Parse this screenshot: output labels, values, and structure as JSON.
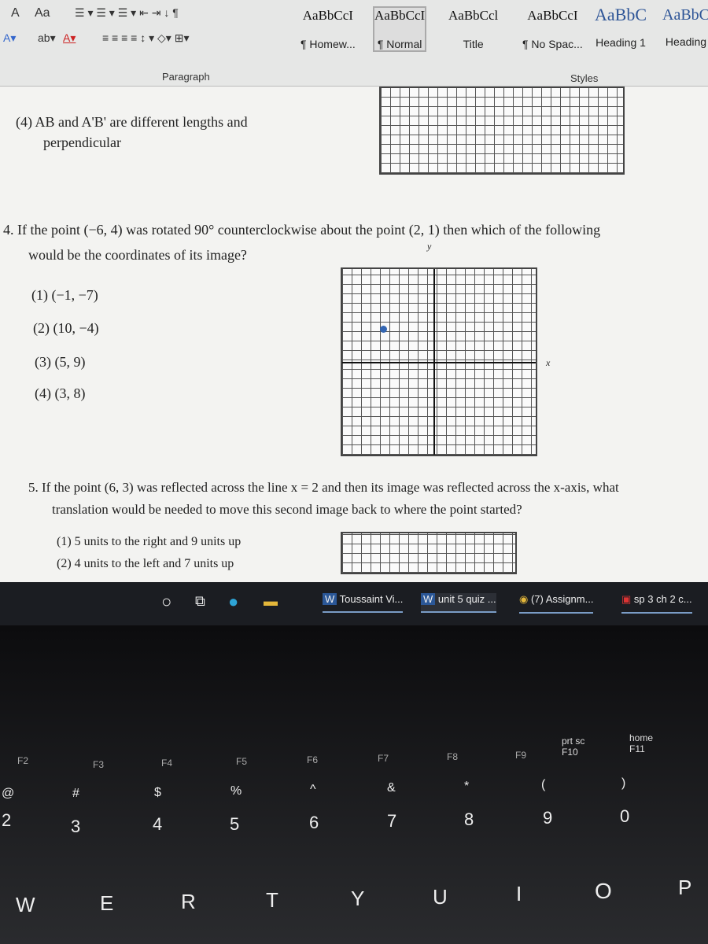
{
  "ribbon": {
    "font_size_label": "Aa",
    "paragraph_group": "Paragraph",
    "styles_group": "Styles",
    "styles": [
      {
        "preview": "AaBbCcI",
        "label": "¶ Homew..."
      },
      {
        "preview": "AaBbCcI",
        "label": "¶ Normal"
      },
      {
        "preview": "AaBbCcl",
        "label": "Title"
      },
      {
        "preview": "AaBbCcI",
        "label": "¶ No Spac..."
      },
      {
        "preview": "AaBbC",
        "label": "Heading 1"
      },
      {
        "preview": "AaBbC",
        "label": "Heading"
      }
    ]
  },
  "document": {
    "prev_choice_4a": "(4) AB and A'B' are different lengths and",
    "prev_choice_4b": "perpendicular",
    "q4_line1": "4. If the point (−6, 4) was rotated 90° counterclockwise about the point (2, 1) then which of the following",
    "q4_line2": "would be the coordinates of its image?",
    "q4_choices": [
      "(1) (−1, −7)",
      "(2) (10, −4)",
      "(3) (5, 9)",
      "(4) (3, 8)"
    ],
    "axis_y": "y",
    "axis_x": "x",
    "q5_line1": "5. If the point (6, 3) was reflected across the line x = 2 and then its image was reflected across the x-axis, what",
    "q5_line2": "translation would be needed to move this second image back to where the point started?",
    "q5_choices": [
      "(1) 5 units to the right and 9 units up",
      "(2) 4 units to the left and 7 units up"
    ]
  },
  "taskbar": {
    "items": [
      {
        "icon": "word-icon",
        "label": "Toussaint Vi..."
      },
      {
        "icon": "word-icon",
        "label": "unit 5 quiz ..."
      },
      {
        "icon": "chrome-icon",
        "label": "(7) Assignm..."
      },
      {
        "icon": "pdf-icon",
        "label": "sp 3 ch 2 c..."
      }
    ]
  },
  "keyboard": {
    "fkeys": [
      "F2",
      "F3",
      "F4",
      "F5",
      "F6",
      "F7",
      "F8",
      "F9",
      "prt sc F10",
      "home F11"
    ],
    "numbers": [
      [
        "@",
        "2"
      ],
      [
        "#",
        "3"
      ],
      [
        "$",
        "4"
      ],
      [
        "%",
        "5"
      ],
      [
        "^",
        "6"
      ],
      [
        "&",
        "7"
      ],
      [
        "*",
        "8"
      ],
      [
        "(",
        "9"
      ],
      [
        ")",
        "0"
      ]
    ],
    "letters": [
      "W",
      "E",
      "R",
      "T",
      "Y",
      "U",
      "I",
      "O",
      "P"
    ]
  }
}
